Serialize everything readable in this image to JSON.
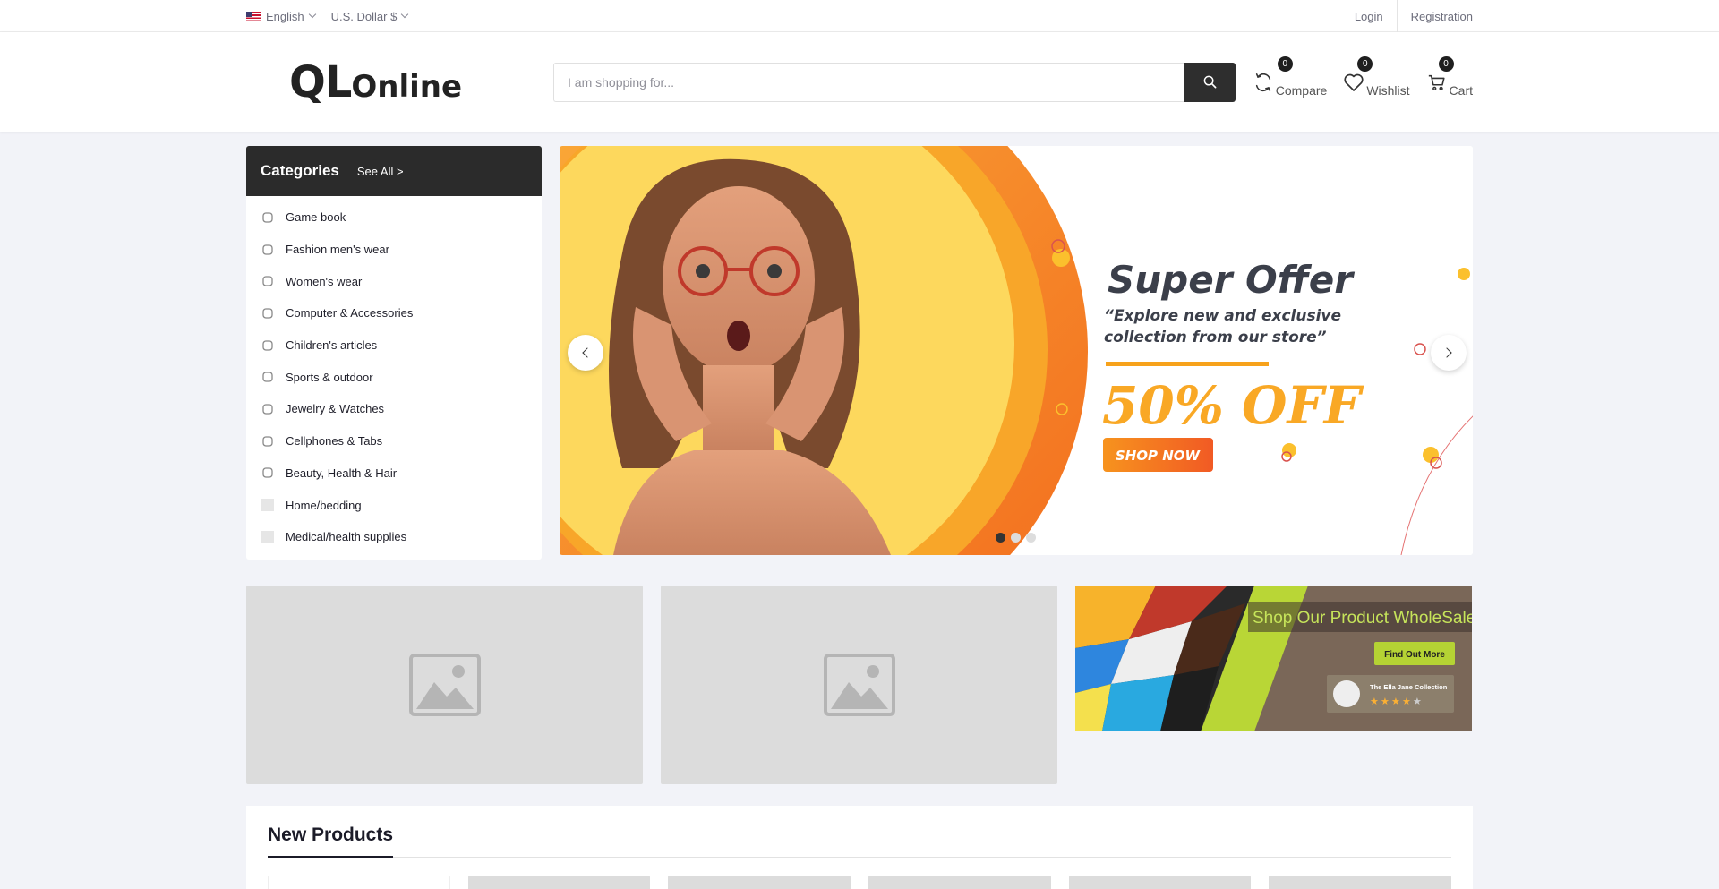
{
  "topbar": {
    "language": "English",
    "currency": "U.S. Dollar $",
    "login": "Login",
    "registration": "Registration"
  },
  "header": {
    "logo_main": "QL",
    "logo_sub": "Online",
    "search_placeholder": "I am shopping for...",
    "compare": {
      "label": "Compare",
      "count": "0"
    },
    "wishlist": {
      "label": "Wishlist",
      "count": "0"
    },
    "cart": {
      "label": "Cart",
      "count": "0"
    }
  },
  "categories": {
    "title": "Categories",
    "see_all": "See All >",
    "items": [
      {
        "label": "Game book",
        "icon": "gamepad-icon"
      },
      {
        "label": "Fashion men's wear",
        "icon": "shirt-icon"
      },
      {
        "label": "Women's wear",
        "icon": "dress-icon"
      },
      {
        "label": "Computer & Accessories",
        "icon": "computer-icon"
      },
      {
        "label": "Children's articles",
        "icon": "baby-icon"
      },
      {
        "label": "Sports & outdoor",
        "icon": "sports-icon"
      },
      {
        "label": "Jewelry & Watches",
        "icon": "watch-icon"
      },
      {
        "label": "Cellphones & Tabs",
        "icon": "phone-icon"
      },
      {
        "label": "Beauty, Health & Hair",
        "icon": "beauty-icon"
      },
      {
        "label": "Home/bedding",
        "icon": "placeholder-icon"
      },
      {
        "label": "Medical/health supplies",
        "icon": "placeholder-icon"
      }
    ]
  },
  "slider": {
    "headline": "Super Offer",
    "subline1": "“Explore new and exclusive",
    "subline2": "collection from our store”",
    "discount": "50% OFF",
    "cta": "SHOP NOW",
    "active_slide": 1,
    "slide_count": 3
  },
  "wholesale_banner": {
    "title": "Shop Our Product WholeSale",
    "button": "Find Out More",
    "badge": "The Ella Jane Collection",
    "rating": 4
  },
  "new_products": {
    "title": "New Products"
  },
  "colors": {
    "dark": "#2b2b2b",
    "accent_orange": "#f7931e",
    "accent_yellow": "#fcd34d",
    "lime": "#b5d334"
  }
}
